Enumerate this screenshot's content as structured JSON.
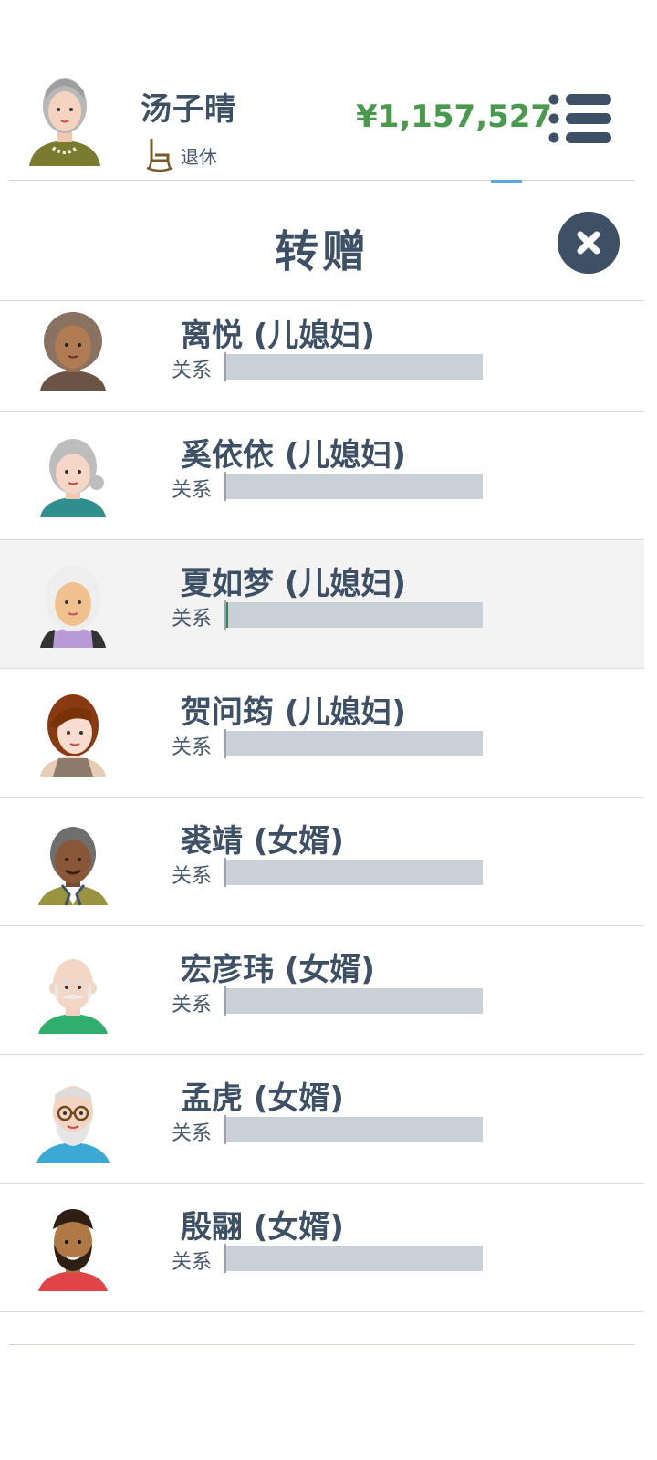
{
  "player": {
    "name": "汤子晴",
    "status": "退休",
    "status_icon": "rocking-chair-icon",
    "money": "¥1,157,527"
  },
  "header": {
    "menu_icon": "menu-list-icon"
  },
  "modal": {
    "title": "转赠",
    "close_icon": "close-icon"
  },
  "relatives": [
    {
      "name": "离悦 (儿媳妇)",
      "relation_label": "关系",
      "relation_level": 0.0,
      "avatar": "avatar-curly-hair-woman"
    },
    {
      "name": "奚依依 (儿媳妇)",
      "relation_label": "关系",
      "relation_level": 0.0,
      "avatar": "avatar-elderly-woman-bun"
    },
    {
      "name": "夏如梦 (儿媳妇)",
      "relation_label": "关系",
      "relation_level": 0.01,
      "avatar": "avatar-white-hair-woman",
      "selected": true
    },
    {
      "name": "贺问筠 (儿媳妇)",
      "relation_label": "关系",
      "relation_level": 0.0,
      "avatar": "avatar-brown-hair-woman"
    },
    {
      "name": "裘靖 (女婿)",
      "relation_label": "关系",
      "relation_level": 0.0,
      "avatar": "avatar-gray-hair-man"
    },
    {
      "name": "宏彦玮 (女婿)",
      "relation_label": "关系",
      "relation_level": 0.0,
      "avatar": "avatar-bald-mustache-man"
    },
    {
      "name": "孟虎 (女婿)",
      "relation_label": "关系",
      "relation_level": 0.0,
      "avatar": "avatar-glasses-beard-man"
    },
    {
      "name": "殷翮 (女婿)",
      "relation_label": "关系",
      "relation_level": 0.0,
      "avatar": "avatar-beard-man"
    }
  ],
  "colors": {
    "text": "#3e5066",
    "money": "#4a9a4d",
    "bar_track": "#c9d0d8",
    "bar_fill": "#2e8b4a",
    "selected_row": "#f3f3f3"
  }
}
